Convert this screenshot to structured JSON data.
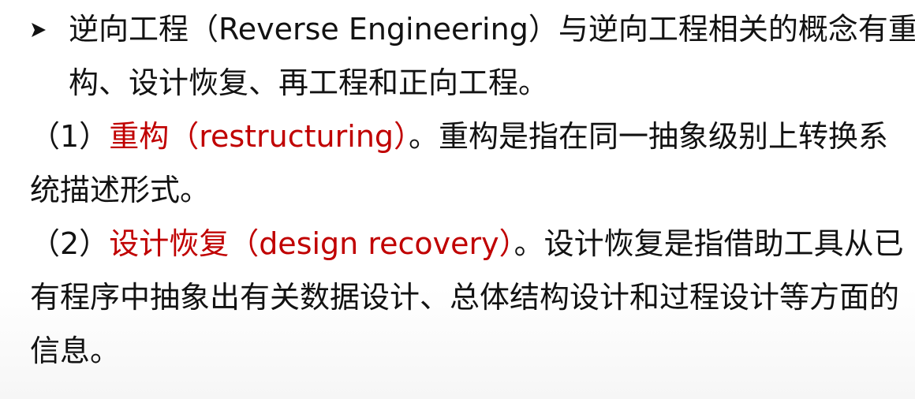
{
  "colors": {
    "text": "#121212",
    "highlight": "#c00000",
    "background": "#ffffff"
  },
  "bullet_icon": "right-arrowhead-bullet",
  "intro": {
    "line1": "逆向工程（Reverse Engineering）与逆向工程相关的概念有重",
    "line2": "构、设计恢复、再工程和正向工程。"
  },
  "item1": {
    "prefix": "（1）",
    "term": "重构（restructuring）",
    "rest": "。重构是指在同一抽象级别上转换系",
    "line2": "统描述形式。"
  },
  "item2": {
    "prefix": "（2）",
    "term": "设计恢复（design recovery）",
    "rest": "。设计恢复是指借助工具从已",
    "line2": "有程序中抽象出有关数据设计、总体结构设计和过程设计等方面的",
    "line3": "信息。"
  }
}
